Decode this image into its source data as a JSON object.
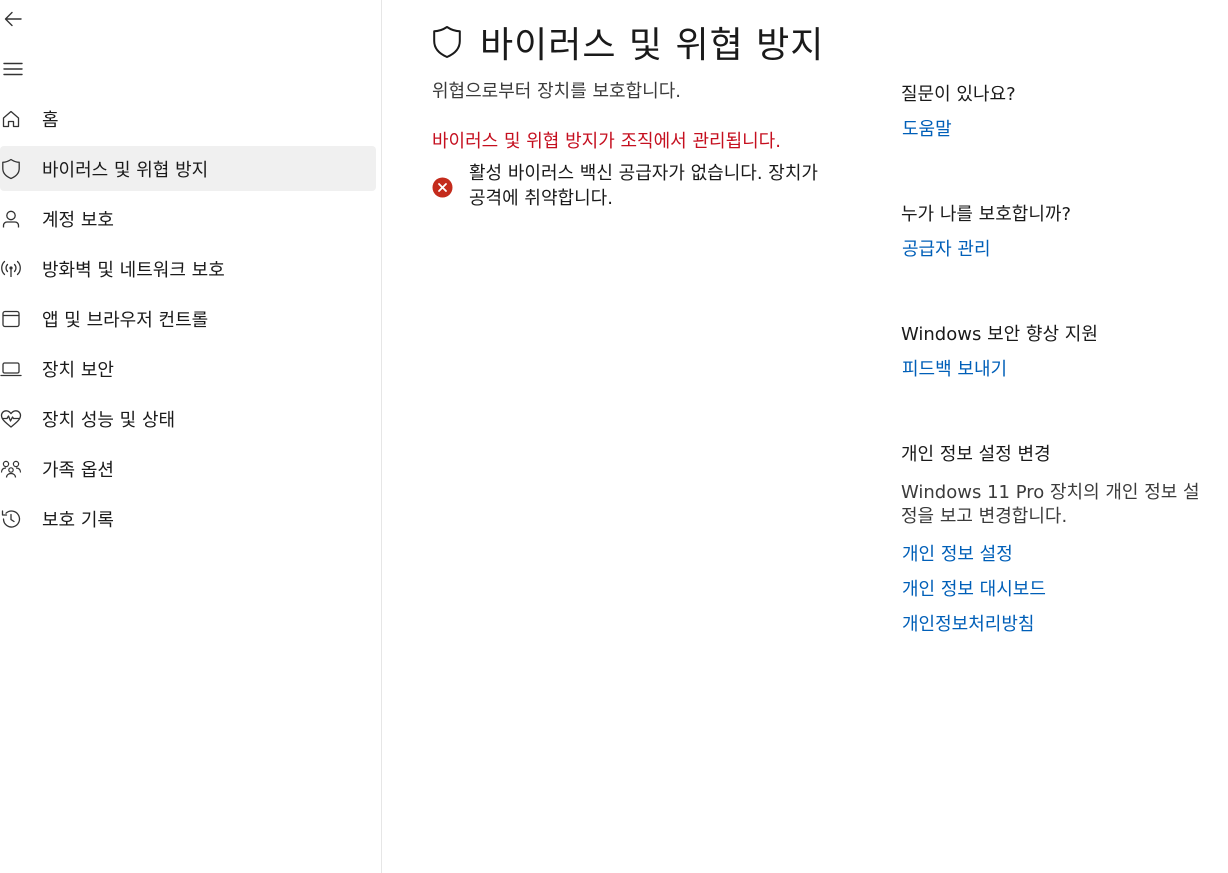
{
  "sidebar": {
    "back_icon": "back-arrow-icon",
    "menu_icon": "hamburger-menu-icon",
    "items": [
      {
        "label": "홈",
        "icon": "home-icon"
      },
      {
        "label": "바이러스 및 위협 방지",
        "icon": "shield-icon",
        "active": true
      },
      {
        "label": "계정 보호",
        "icon": "person-icon"
      },
      {
        "label": "방화벽 및 네트워크 보호",
        "icon": "wireless-antenna-icon"
      },
      {
        "label": "앱 및 브라우저 컨트롤",
        "icon": "app-window-icon"
      },
      {
        "label": "장치 보안",
        "icon": "laptop-icon"
      },
      {
        "label": "장치 성능 및 상태",
        "icon": "heart-pulse-icon"
      },
      {
        "label": "가족 옵션",
        "icon": "family-icon"
      },
      {
        "label": "보호 기록",
        "icon": "history-icon"
      }
    ]
  },
  "main": {
    "title": "바이러스 및 위협 방지",
    "subtitle": "위협으로부터 장치를 보호합니다.",
    "managed_notice": "바이러스 및 위협 방지가 조직에서 관리됩니다.",
    "warning_text": "활성 바이러스 백신 공급자가 없습니다. 장치가 공격에 취약합니다.",
    "warning_color": "#c42b1c",
    "managed_color": "#c50f1f"
  },
  "right_panel": {
    "question": {
      "heading": "질문이 있나요?",
      "link": "도움말"
    },
    "protector": {
      "heading": "누가 나를 보호합니까?",
      "link": "공급자 관리"
    },
    "improve": {
      "heading": "Windows 보안 향상 지원",
      "link": "피드백 보내기"
    },
    "privacy": {
      "heading": "개인 정보 설정 변경",
      "description": "Windows 11 Pro 장치의 개인 정보 설정을 보고 변경합니다.",
      "links": [
        "개인 정보 설정",
        "개인 정보 대시보드",
        "개인정보처리방침"
      ]
    },
    "link_color": "#005fb8"
  }
}
